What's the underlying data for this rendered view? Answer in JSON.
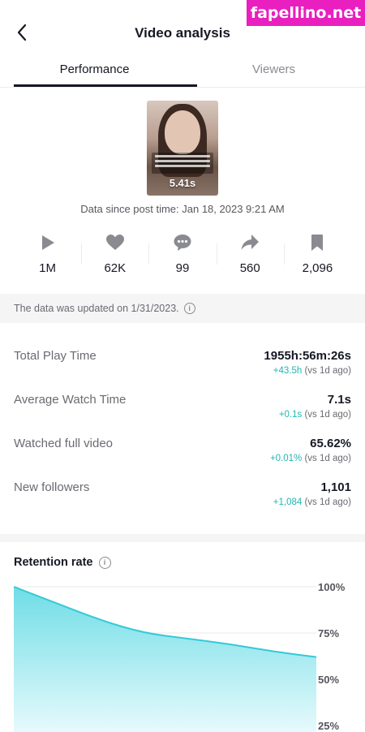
{
  "watermark": "fapellino.net",
  "header": {
    "title": "Video analysis",
    "back_icon": "chevron-left-icon"
  },
  "tabs": [
    {
      "label": "Performance",
      "active": true
    },
    {
      "label": "Viewers",
      "active": false
    }
  ],
  "video": {
    "duration": "5.41s",
    "posted": "Data since post time: Jan 18, 2023 9:21 AM"
  },
  "stats": [
    {
      "icon": "play-icon",
      "value": "1M"
    },
    {
      "icon": "heart-icon",
      "value": "62K"
    },
    {
      "icon": "comment-icon",
      "value": "99"
    },
    {
      "icon": "share-icon",
      "value": "560"
    },
    {
      "icon": "bookmark-icon",
      "value": "2,096"
    }
  ],
  "notice": "The data was updated on 1/31/2023.",
  "metrics": [
    {
      "label": "Total Play Time",
      "value": "1955h:56m:26s",
      "delta": "+43.5h",
      "delta_suffix": " (vs 1d ago)"
    },
    {
      "label": "Average Watch Time",
      "value": "7.1s",
      "delta": "+0.1s",
      "delta_suffix": " (vs 1d ago)"
    },
    {
      "label": "Watched full video",
      "value": "65.62%",
      "delta": "+0.01%",
      "delta_suffix": " (vs 1d ago)"
    },
    {
      "label": "New followers",
      "value": "1,101",
      "delta": "+1,084",
      "delta_suffix": " (vs 1d ago)"
    }
  ],
  "retention": {
    "title": "Retention rate"
  },
  "colors": {
    "accent": "#20b7b3",
    "area_top": "#6fdde6",
    "area_bottom": "#e6fafc"
  },
  "chart_data": {
    "type": "area",
    "title": "Retention rate",
    "y_ticks": [
      "100%",
      "75%",
      "50%",
      "25%"
    ],
    "ylim": [
      25,
      100
    ],
    "x": [
      0,
      1,
      2,
      3,
      4,
      5,
      6,
      7
    ],
    "values": [
      100,
      91,
      82,
      75,
      72,
      69,
      65,
      62
    ]
  }
}
